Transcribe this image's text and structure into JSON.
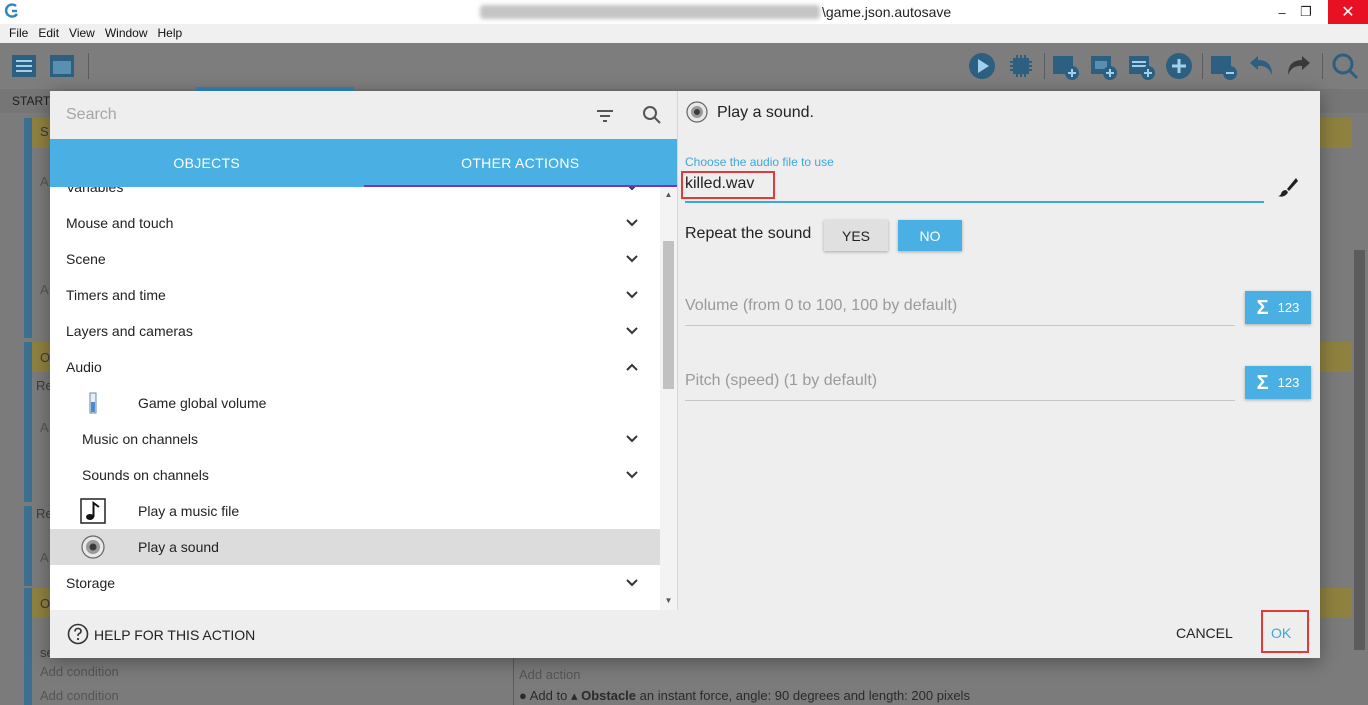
{
  "window": {
    "title_suffix": "\\game.json.autosave",
    "minimize_label": "–",
    "restore_label": "❐",
    "close_label": "✕"
  },
  "menu": {
    "items": [
      "File",
      "Edit",
      "View",
      "Window",
      "Help"
    ]
  },
  "background": {
    "start_tab": "START",
    "visible_fragments": [
      "S",
      "A",
      "A",
      "O",
      "Re",
      "A",
      "Re",
      "A",
      "O",
      "se",
      "Add condition",
      "Add condition",
      "Add action"
    ],
    "bottom_action": {
      "prefix": "Add to",
      "object": "Obstacle",
      "suffix": "an instant force, angle: 90 degrees and length: 200 pixels"
    }
  },
  "dialog": {
    "search": {
      "placeholder": "Search",
      "value": ""
    },
    "tabs": [
      {
        "label": "Objects",
        "active": false
      },
      {
        "label": "Other actions",
        "active": true
      }
    ],
    "list": [
      {
        "label": "Variables",
        "type": "group",
        "expanded": false
      },
      {
        "label": "Mouse and touch",
        "type": "group",
        "expanded": false
      },
      {
        "label": "Scene",
        "type": "group",
        "expanded": false
      },
      {
        "label": "Timers and time",
        "type": "group",
        "expanded": false
      },
      {
        "label": "Layers and cameras",
        "type": "group",
        "expanded": false
      },
      {
        "label": "Audio",
        "type": "group",
        "expanded": true
      },
      {
        "label": "Game global volume",
        "type": "action",
        "icon": "volume-slider-icon"
      },
      {
        "label": "Music on channels",
        "type": "subgroup",
        "expanded": false
      },
      {
        "label": "Sounds on channels",
        "type": "subgroup",
        "expanded": false
      },
      {
        "label": "Play a music file",
        "type": "action",
        "icon": "music-note-icon"
      },
      {
        "label": "Play a sound",
        "type": "action",
        "icon": "speaker-icon",
        "selected": true
      },
      {
        "label": "Storage",
        "type": "group",
        "expanded": false
      }
    ],
    "action": {
      "title": "Play a sound.",
      "audio_file_label": "Choose the audio file to use",
      "audio_file_value": "killed.wav",
      "repeat_label": "Repeat the sound",
      "repeat_yes": "Yes",
      "repeat_no": "No",
      "repeat_selected": "No",
      "volume_placeholder": "Volume (from 0 to 100, 100 by default)",
      "pitch_placeholder": "Pitch (speed) (1 by default)",
      "expression_button_label": "123"
    },
    "footer": {
      "help_label": "Help for this action",
      "cancel_label": "Cancel",
      "ok_label": "OK"
    }
  },
  "colors": {
    "accent": "#4ab0e4",
    "tab_indicator": "#7a35b8",
    "highlight_box": "#e03a3a"
  }
}
